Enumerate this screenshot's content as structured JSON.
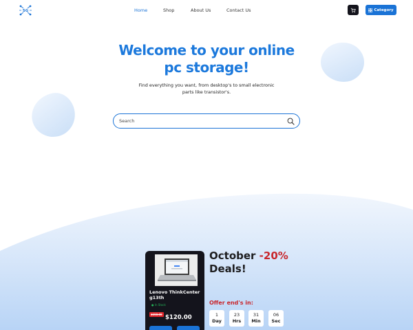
{
  "nav": {
    "logo_text": "SG",
    "links": [
      {
        "label": "Home",
        "active": true
      },
      {
        "label": "Shop",
        "active": false
      },
      {
        "label": "About Us",
        "active": false
      },
      {
        "label": "Contact Us",
        "active": false
      }
    ],
    "cart_icon": "cart-icon",
    "category_button": {
      "label": "Category",
      "icon": "grid-icon"
    }
  },
  "hero": {
    "title_line1": "Welcome to your online",
    "title_line2": "pc storage!",
    "subtitle_line1": "Find everything you want, from desktop's to small electronic",
    "subtitle_line2": "parts like transistor's."
  },
  "search": {
    "placeholder": "Search",
    "value": "",
    "icon": "search-icon"
  },
  "deal_card": {
    "product_name": "Lenovo ThinkCenter g13th",
    "stock_status": "● In Stock",
    "old_price": "$150.00",
    "price": "$120.00",
    "image": "laptop-image"
  },
  "deal": {
    "title_word": "October",
    "discount": "-20%",
    "title_line2": "Deals!",
    "offer_label": "Offer end's in:",
    "countdown": [
      {
        "value": "1",
        "unit": "Day"
      },
      {
        "value": "23",
        "unit": "Hrs"
      },
      {
        "value": "31",
        "unit": "Min"
      },
      {
        "value": "06",
        "unit": "Sec"
      }
    ]
  },
  "colors": {
    "accent": "#1a73d6",
    "title_blue": "#1c79dc",
    "discount_red": "#c8262c",
    "dark": "#14141c",
    "stock_green": "#25b75a"
  }
}
